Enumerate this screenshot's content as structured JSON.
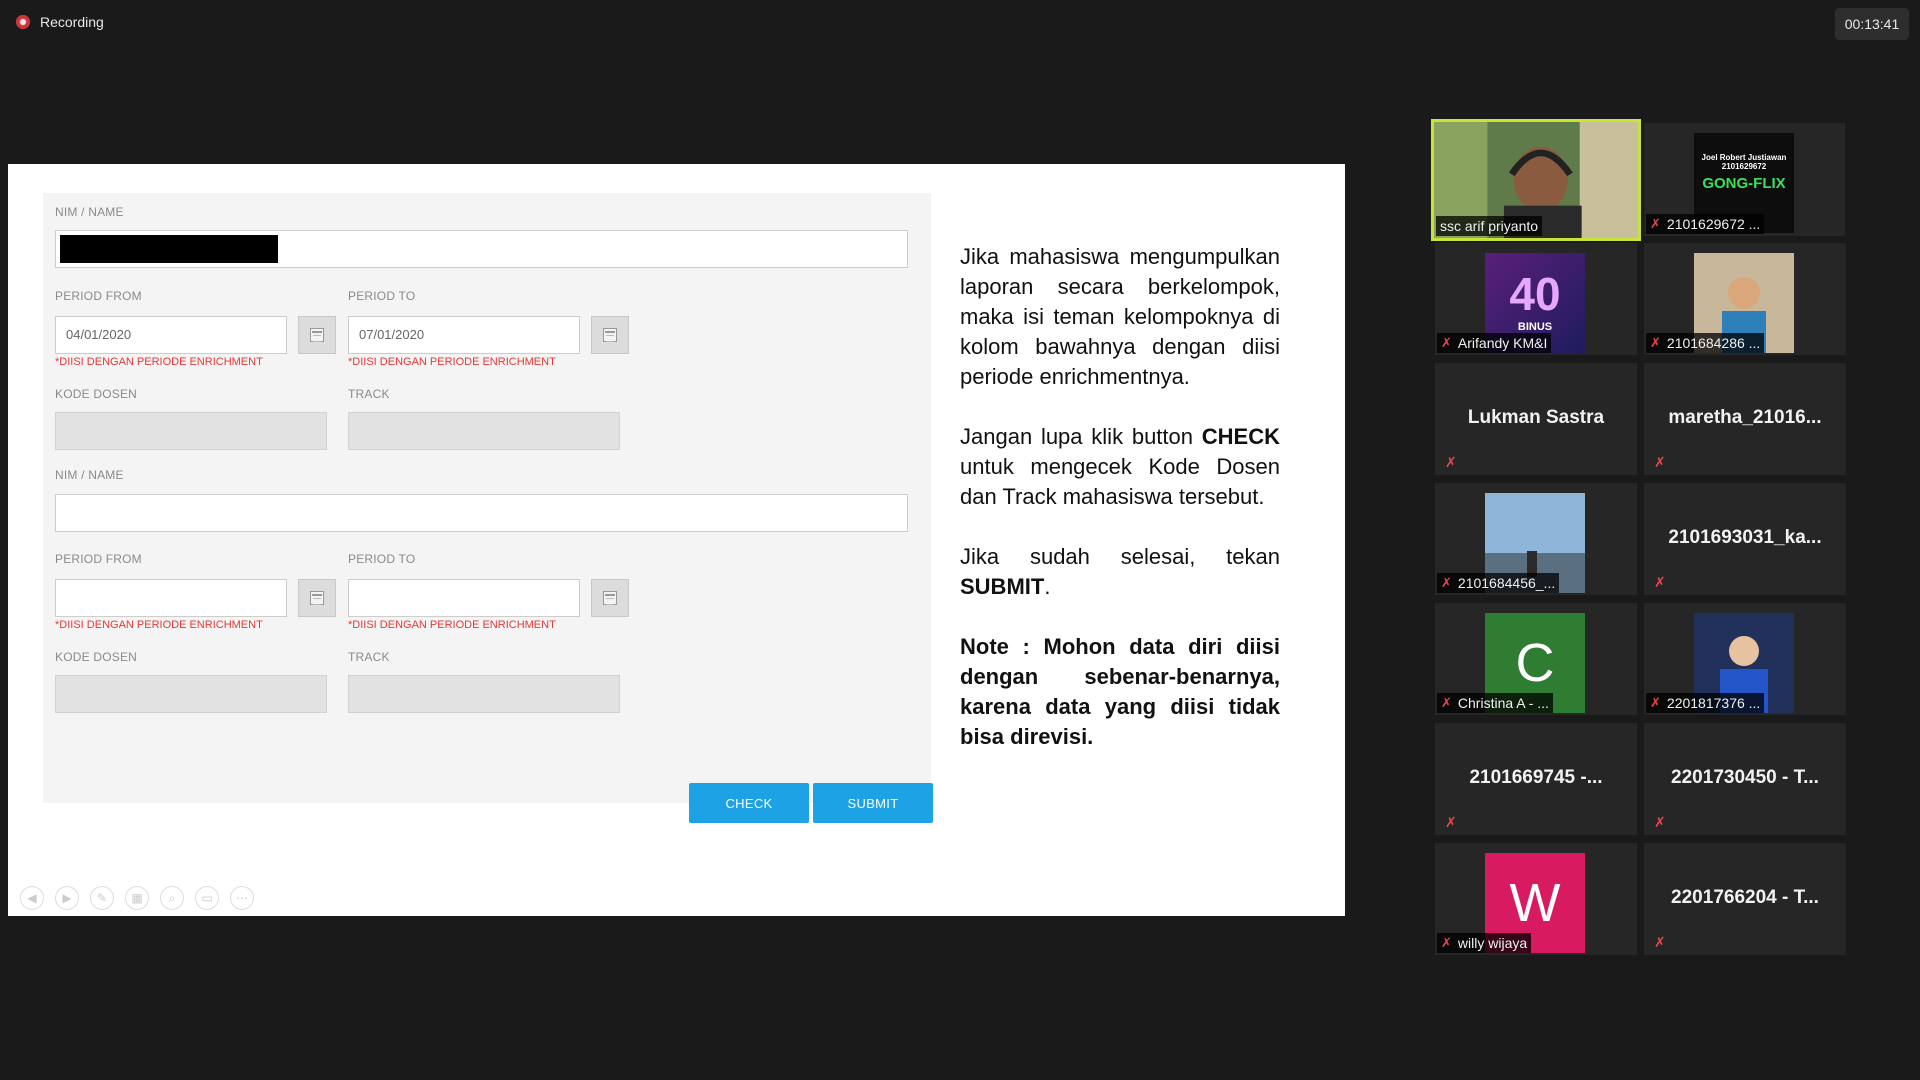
{
  "top": {
    "recording": "Recording",
    "timer": "00:13:41"
  },
  "form": {
    "block1": {
      "name_label": "NIM / NAME",
      "from_label": "PERIOD FROM",
      "from_value": "04/01/2020",
      "to_label": "PERIOD TO",
      "to_value": "07/01/2020",
      "hint": "*DIISI DENGAN PERIODE ENRICHMENT",
      "kode_label": "KODE DOSEN",
      "track_label": "TRACK"
    },
    "block2": {
      "name_label": "NIM / NAME",
      "from_label": "PERIOD FROM",
      "to_label": "PERIOD TO",
      "hint": "*DIISI DENGAN PERIODE ENRICHMENT",
      "kode_label": "KODE DOSEN",
      "track_label": "TRACK"
    },
    "check": "CHECK",
    "submit": "SUBMIT"
  },
  "note": {
    "p1": "Jika mahasiswa mengumpulkan laporan secara berkelompok, maka isi teman kelompoknya di kolom bawahnya dengan diisi periode enrichmentnya.",
    "p2_a": "Jangan lupa klik button ",
    "p2_b": "CHECK",
    "p2_c": " untuk mengecek Kode Dosen dan Track mahasiswa tersebut.",
    "p3_a": "Jika sudah selesai, tekan ",
    "p3_b": "SUBMIT",
    "p3_c": ".",
    "p4": "Note : Mohon data diri diisi dengan sebenar-benarnya, karena data yang diisi tidak bisa direvisi."
  },
  "participants": [
    {
      "name": "ssc arif priyanto",
      "type": "video",
      "color": "#4a6b3a"
    },
    {
      "name": "2101629672 ...",
      "type": "image",
      "color": "#0d0d0d"
    },
    {
      "name": "Arifandy KM&I",
      "type": "image",
      "color": "#3a1d5c"
    },
    {
      "name": "2101684286 ...",
      "type": "image",
      "color": "#b49a7a"
    },
    {
      "name": "Lukman Sastra",
      "type": "text"
    },
    {
      "name": "maretha_21016...",
      "type": "text"
    },
    {
      "name": "2101684456_...",
      "type": "image",
      "color": "#7fa6c9"
    },
    {
      "name": "2101693031_ka...",
      "type": "text"
    },
    {
      "name": "Christina A - ...",
      "type": "letter",
      "letter": "C",
      "color": "#2e7d32"
    },
    {
      "name": "2201817376 ...",
      "type": "image",
      "color": "#22315c"
    },
    {
      "name": "2101669745 -...",
      "type": "text"
    },
    {
      "name": "2201730450 - T...",
      "type": "text"
    },
    {
      "name": "willy wijaya",
      "type": "letter",
      "letter": "W",
      "color": "#d81b60"
    },
    {
      "name": "2201766204 - T...",
      "type": "text"
    }
  ],
  "gong_flix": {
    "line1": "Joel Robert Justiawan",
    "line2": "2101629672",
    "title": "GONG-FLIX"
  },
  "binus": {
    "number": "40",
    "brand": "BINUS"
  }
}
